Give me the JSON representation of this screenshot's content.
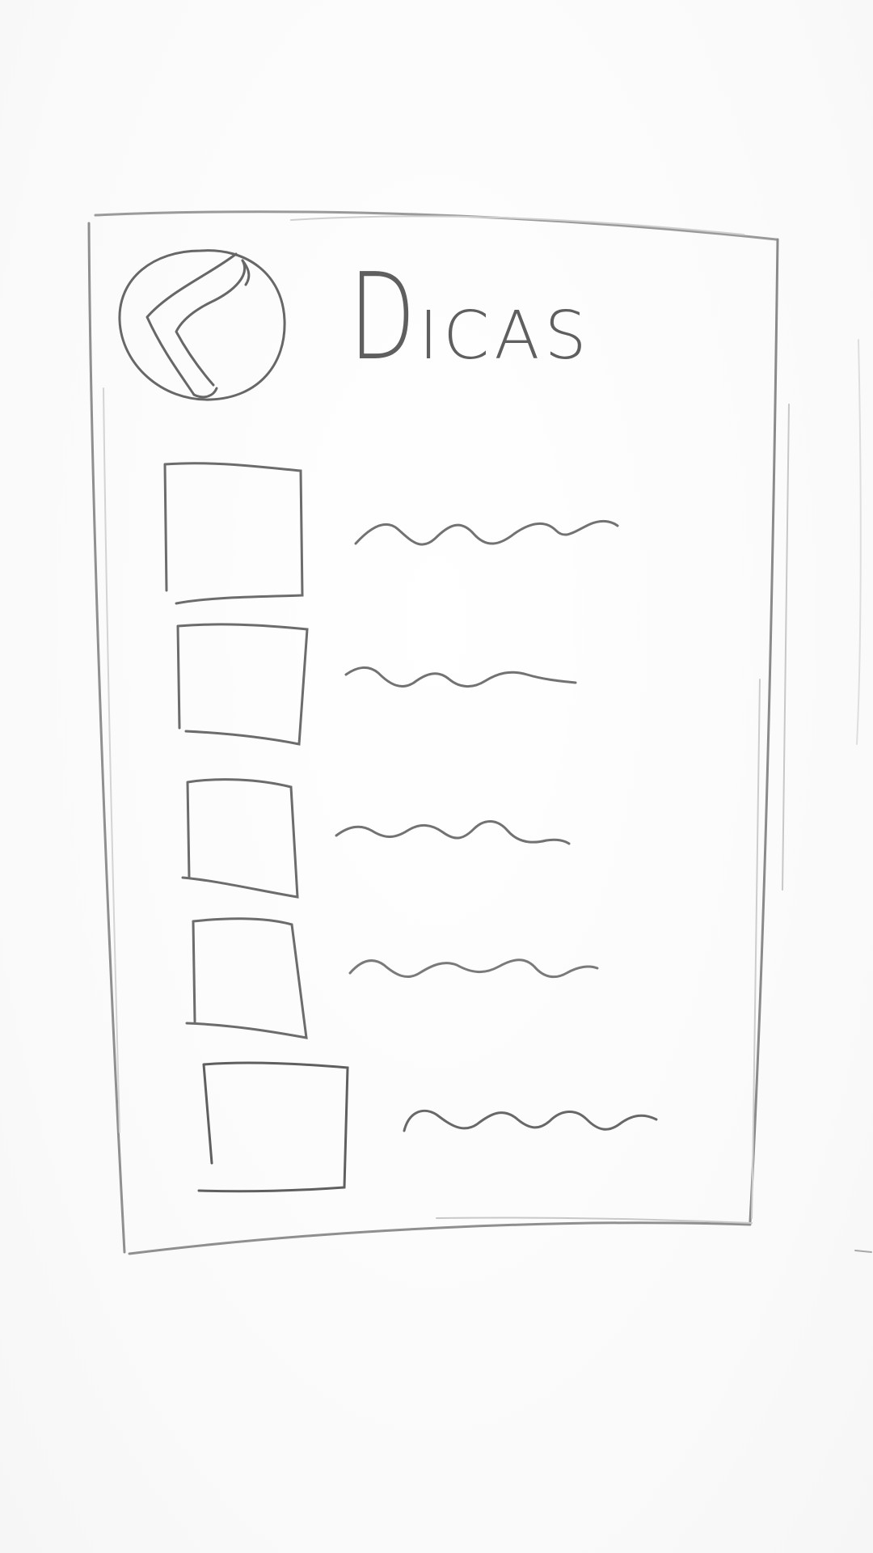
{
  "header": {
    "title_first": "D",
    "title_rest": "ICAS",
    "back_icon": "chevron-left-circle-icon"
  },
  "list": {
    "items": [
      {
        "thumbnail": "image-placeholder",
        "text": "text-placeholder-scribble"
      },
      {
        "thumbnail": "image-placeholder",
        "text": "text-placeholder-scribble"
      },
      {
        "thumbnail": "image-placeholder",
        "text": "text-placeholder-scribble"
      },
      {
        "thumbnail": "image-placeholder",
        "text": "text-placeholder-scribble"
      },
      {
        "thumbnail": "image-placeholder",
        "text": "text-placeholder-scribble"
      }
    ]
  },
  "colors": {
    "paper": "#fbfbfb",
    "pencil": "#6a6a6a",
    "pencil_light": "#b9b9b9"
  }
}
